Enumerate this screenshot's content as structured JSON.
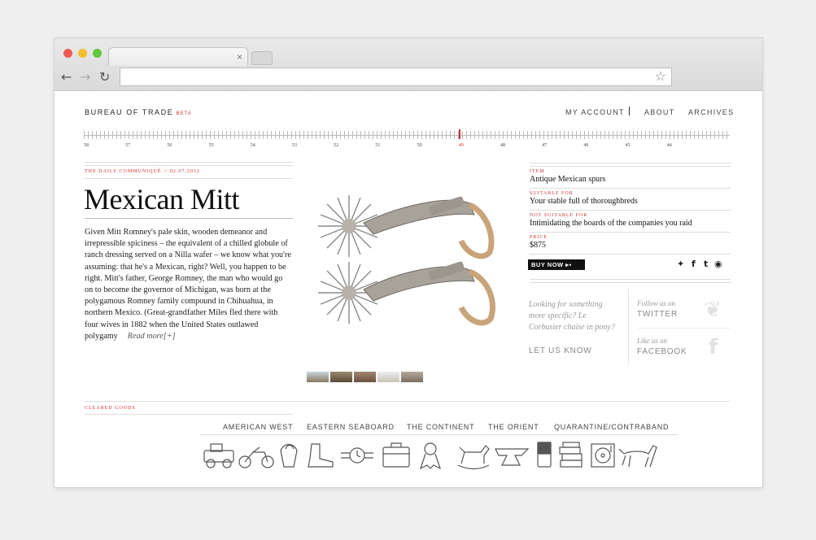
{
  "browser": {
    "url_value": "",
    "tab_close": "×"
  },
  "site": {
    "logo": "BUREAU OF TRADE",
    "beta": "BETA"
  },
  "nav": {
    "my_account": "MY ACCOUNT",
    "about": "ABOUT",
    "archives": "ARCHIVES"
  },
  "timeline": {
    "numbers": [
      "58",
      "57",
      "56",
      "55",
      "54",
      "53",
      "52",
      "51",
      "50",
      "49",
      "48",
      "47",
      "46",
      "45",
      "44"
    ],
    "current": "49"
  },
  "article": {
    "kicker": "THE DAILY COMMUNIQUÉ // 02.07.2012",
    "title": "Mexican Mitt",
    "body": "Given Mitt Romney's pale skin, wooden demeanor and irrepressible spiciness – the equivalent of a chilled globule of ranch dressing served on a Nilla wafer – we know what you're assuming: that he's a Mexican, right? Well, you happen to be right. Mitt's father, George Romney, the man who would go on to become the governor of Michigan, was born at the polygamous Romney family compound in Chihuahua, in northern Mexico. (Great-grandfather Miles fled there with four wives in 1882 when the United States outlawed polygamy",
    "read_more": "Read more[+]"
  },
  "product": {
    "item_label": "ITEM",
    "item": "Antique Mexican spurs",
    "suitable_label": "SUITABLE FOR",
    "suitable": "Your stable full of thoroughbreds",
    "not_suitable_label": "NOT SUITABLE FOR",
    "not_suitable": "Intimidating the boards of the companies you raid",
    "price_label": "PRICE",
    "price": "$875",
    "buy": "BUY NOW"
  },
  "share_icons": [
    "twitter-icon",
    "facebook-icon",
    "tumblr-icon",
    "stumbleupon-icon"
  ],
  "contact": {
    "question": "Looking for something more specific? Le Corbusier chaise in pony?",
    "cta": "LET US KNOW",
    "follow_twitter_label": "Follow us on",
    "twitter": "TWITTER",
    "like_facebook_label": "Like us on",
    "facebook": "FACEBOOK"
  },
  "cleared": {
    "heading": "CLEARED GOODS",
    "categories": [
      "AMERICAN WEST",
      "EASTERN SEABOARD",
      "THE CONTINENT",
      "THE ORIENT",
      "QUARANTINE/CONTRABAND"
    ],
    "icons": [
      "jeep-icon",
      "motorcycle-icon",
      "bag-icon",
      "boot-icon",
      "watch-icon",
      "briefcase-icon",
      "ribbon-icon",
      "rocking-horse-icon",
      "anvil-icon",
      "soup-can-icon",
      "books-icon",
      "record-player-icon",
      "dog-icon"
    ]
  },
  "colors": {
    "accent": "#d0312d",
    "text": "#222222",
    "rule": "#dddddd"
  }
}
